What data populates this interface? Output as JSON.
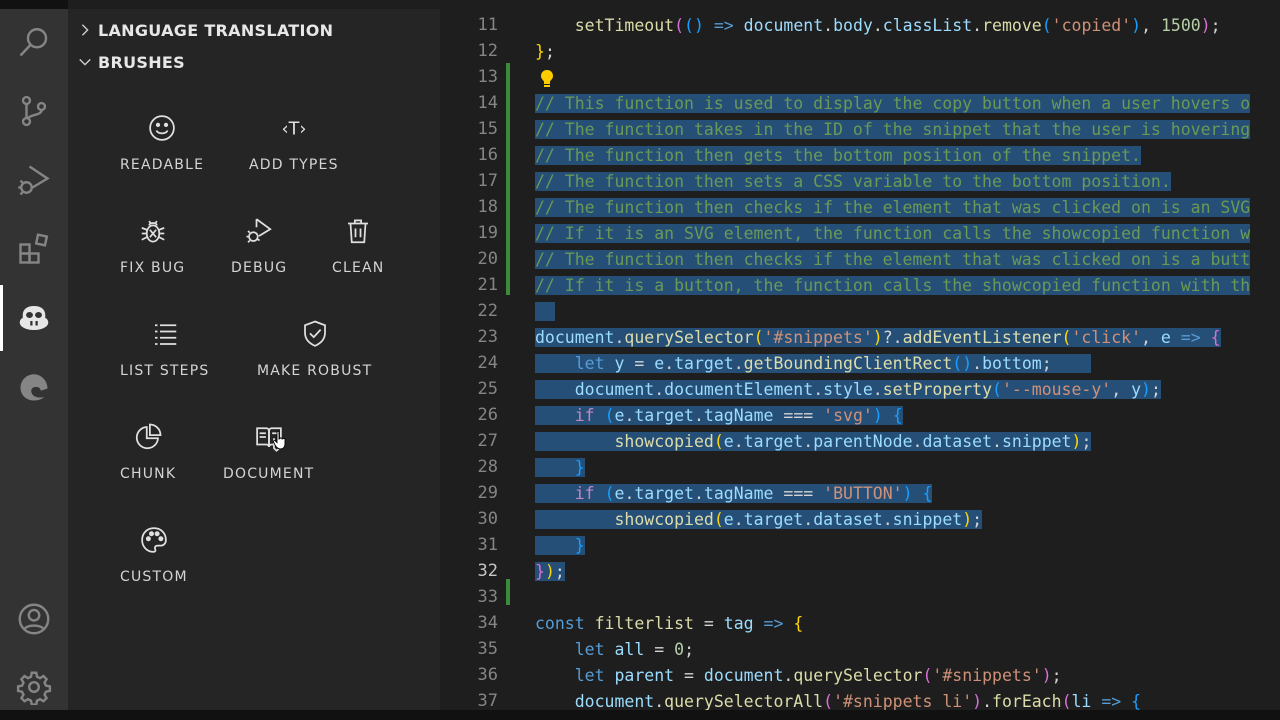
{
  "activity_bar": {
    "items": [
      {
        "icon": "search-icon"
      },
      {
        "icon": "source-control-icon"
      },
      {
        "icon": "run-debug-icon"
      },
      {
        "icon": "extensions-icon"
      },
      {
        "icon": "copilot-labs-icon",
        "active": true
      },
      {
        "icon": "edge-icon"
      }
    ],
    "bottom": [
      {
        "icon": "account-icon"
      },
      {
        "icon": "gear-icon"
      }
    ]
  },
  "sidebar": {
    "sections": [
      {
        "label": "LANGUAGE TRANSLATION",
        "expanded": false
      },
      {
        "label": "BRUSHES",
        "expanded": true
      }
    ],
    "brushes": [
      {
        "label": "READABLE",
        "icon": "smiley-icon"
      },
      {
        "label": "ADD TYPES",
        "icon": "type-icon"
      },
      {
        "label": "FIX BUG",
        "icon": "bug-icon"
      },
      {
        "label": "DEBUG",
        "icon": "debug-icon"
      },
      {
        "label": "CLEAN",
        "icon": "trash-icon"
      },
      {
        "label": "LIST STEPS",
        "icon": "list-icon"
      },
      {
        "label": "MAKE ROBUST",
        "icon": "shield-check-icon"
      },
      {
        "label": "CHUNK",
        "icon": "pie-chart-icon"
      },
      {
        "label": "DOCUMENT",
        "icon": "book-icon"
      },
      {
        "label": "CUSTOM",
        "icon": "palette-icon"
      }
    ]
  },
  "editor": {
    "current_line": 32,
    "lines": [
      {
        "n": "11",
        "text": "    setTimeout(() => document.body.classList.remove('copied'), 1500);"
      },
      {
        "n": "12",
        "text": "};"
      },
      {
        "n": "13",
        "text": ""
      },
      {
        "n": "14",
        "text": "// This function is used to display the copy button when a user hovers o"
      },
      {
        "n": "15",
        "text": "// The function takes in the ID of the snippet that the user is hovering"
      },
      {
        "n": "16",
        "text": "// The function then gets the bottom position of the snippet."
      },
      {
        "n": "17",
        "text": "// The function then sets a CSS variable to the bottom position."
      },
      {
        "n": "18",
        "text": "// The function then checks if the element that was clicked on is an SVG"
      },
      {
        "n": "19",
        "text": "// If it is an SVG element, the function calls the showcopied function w"
      },
      {
        "n": "20",
        "text": "// The function then checks if the element that was clicked on is a butt"
      },
      {
        "n": "21",
        "text": "// If it is a button, the function calls the showcopied function with th"
      },
      {
        "n": "22",
        "text": ""
      },
      {
        "n": "23",
        "text": "document.querySelector('#snippets')?.addEventListener('click', e => {"
      },
      {
        "n": "24",
        "text": "    let y = e.target.getBoundingClientRect().bottom;"
      },
      {
        "n": "25",
        "text": "    document.documentElement.style.setProperty('--mouse-y', y);"
      },
      {
        "n": "26",
        "text": "    if (e.target.tagName === 'svg') {"
      },
      {
        "n": "27",
        "text": "        showcopied(e.target.parentNode.dataset.snippet);"
      },
      {
        "n": "28",
        "text": "    }"
      },
      {
        "n": "29",
        "text": "    if (e.target.tagName === 'BUTTON') {"
      },
      {
        "n": "30",
        "text": "        showcopied(e.target.dataset.snippet);"
      },
      {
        "n": "31",
        "text": "    }"
      },
      {
        "n": "32",
        "text": "});"
      },
      {
        "n": "33",
        "text": ""
      },
      {
        "n": "34",
        "text": "const filterlist = tag => {"
      },
      {
        "n": "35",
        "text": "    let all = 0;"
      },
      {
        "n": "36",
        "text": "    let parent = document.querySelector('#snippets');"
      },
      {
        "n": "37",
        "text": "    document.querySelectorAll('#snippets li').forEach(li => {"
      }
    ]
  },
  "colors": {
    "activity_bar": "#333333",
    "sidebar": "#252526",
    "editor": "#1e1e1e",
    "selection": "#264f78",
    "comment": "#6a9955",
    "keyword": "#569cd6",
    "function": "#dcdcaa",
    "variable": "#9cdcfe",
    "string": "#ce9178",
    "number": "#b5cea8",
    "gutter_added": "#3a8c3a"
  }
}
